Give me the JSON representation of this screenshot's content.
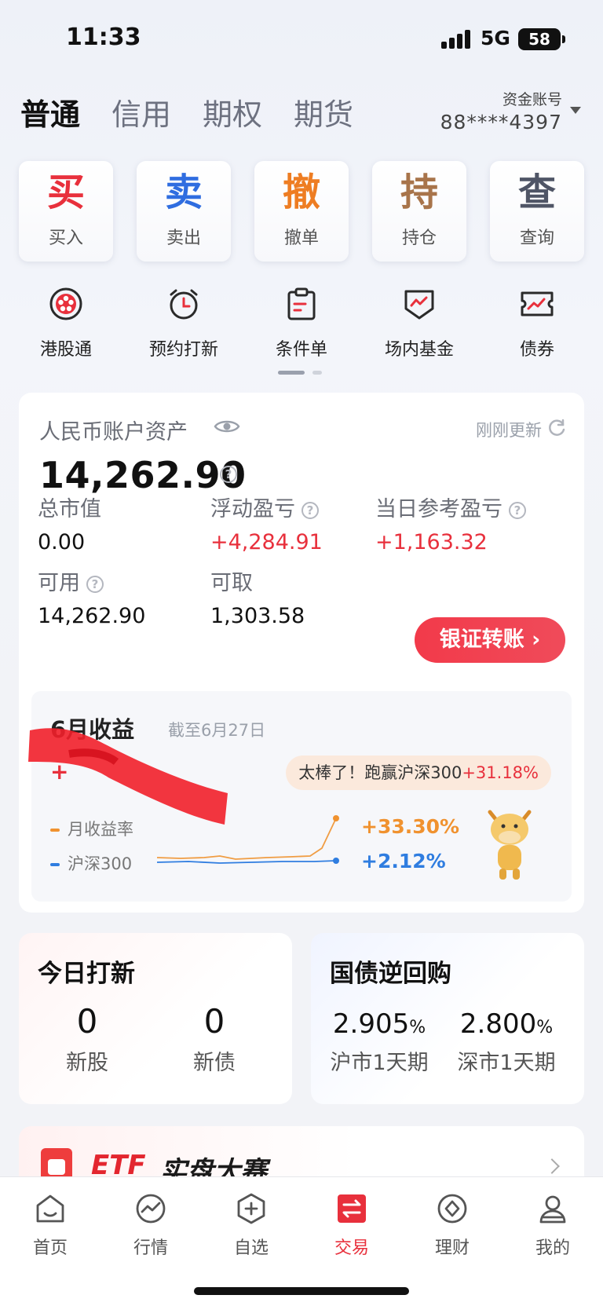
{
  "status": {
    "time": "11:33",
    "network": "5G",
    "battery": "58"
  },
  "tabs": [
    {
      "label": "普通",
      "active": true
    },
    {
      "label": "信用",
      "active": false
    },
    {
      "label": "期权",
      "active": false
    },
    {
      "label": "期货",
      "active": false
    }
  ],
  "account": {
    "label": "资金账号",
    "number": "88****4397"
  },
  "actions": [
    {
      "big": "买",
      "label": "买入",
      "color": "#e8303c"
    },
    {
      "big": "卖",
      "label": "卖出",
      "color": "#2f6de0"
    },
    {
      "big": "撤",
      "label": "撤单",
      "color": "#ee7d22"
    },
    {
      "big": "持",
      "label": "持仓",
      "color": "#a8744a"
    },
    {
      "big": "查",
      "label": "查询",
      "color": "#4f5566"
    }
  ],
  "features": [
    {
      "label": "港股通",
      "icon": "hk-flower-icon"
    },
    {
      "label": "预约打新",
      "icon": "alarm-clock-icon"
    },
    {
      "label": "条件单",
      "icon": "clipboard-icon"
    },
    {
      "label": "场内基金",
      "icon": "fund-shield-icon"
    },
    {
      "label": "债券",
      "icon": "bond-ticket-icon"
    }
  ],
  "asset": {
    "title": "人民币账户资产",
    "updated": "刚刚更新",
    "total": "14,262.90",
    "market_value_label": "总市值",
    "market_value": "0.00",
    "floating_pl_label": "浮动盈亏",
    "floating_pl": "+4,284.91",
    "daily_pl_label": "当日参考盈亏",
    "daily_pl": "+1,163.32",
    "available_label": "可用",
    "available": "14,262.90",
    "withdrawable_label": "可取",
    "withdrawable": "1,303.58",
    "transfer_button": "银证转账"
  },
  "monthly": {
    "title": "6月收益",
    "as_of": "截至6月27日",
    "return_partial": "+",
    "bubble_prefix": "太棒了！跑赢沪深300",
    "bubble_value": "+31.18%",
    "legend_monthly": "月收益率",
    "legend_index": "沪深300",
    "monthly_value": "+33.30%",
    "index_value": "+2.12%",
    "colors": {
      "monthly": "#f0922f",
      "index": "#2f7de0"
    }
  },
  "ipo": {
    "title": "今日打新",
    "stocks": "0",
    "stocks_label": "新股",
    "bonds": "0",
    "bonds_label": "新债"
  },
  "repo": {
    "title": "国债逆回购",
    "sh_rate": "2.905",
    "sh_label": "沪市1天期",
    "sz_rate": "2.800",
    "sz_label": "深市1天期",
    "unit": "%"
  },
  "banner": {
    "etf": "ETF",
    "text": "实盘大赛"
  },
  "nav": [
    {
      "label": "首页",
      "icon": "home-icon",
      "active": false
    },
    {
      "label": "行情",
      "icon": "market-icon",
      "active": false
    },
    {
      "label": "自选",
      "icon": "watchlist-icon",
      "active": false
    },
    {
      "label": "交易",
      "icon": "trade-icon",
      "active": true
    },
    {
      "label": "理财",
      "icon": "wealth-icon",
      "active": false
    },
    {
      "label": "我的",
      "icon": "profile-icon",
      "active": false
    }
  ]
}
